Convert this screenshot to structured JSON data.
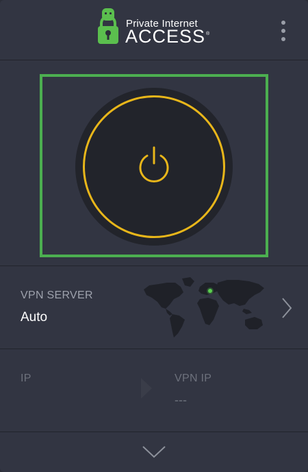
{
  "header": {
    "logo_top": "Private Internet",
    "logo_main": "ACCESS",
    "logo_reg": "®"
  },
  "connect": {
    "state": "disconnected",
    "ring_color": "#e8b61a",
    "focus_color": "#4caf50"
  },
  "server": {
    "label": "VPN SERVER",
    "value": "Auto",
    "location_marker_color": "#4caf50"
  },
  "ip": {
    "label": "IP",
    "value": "",
    "vpn_label": "VPN IP",
    "vpn_value": "---"
  },
  "icons": {
    "menu": "kebab-menu-icon",
    "power": "power-icon",
    "server_chevron": "chevron-right-icon",
    "ip_arrow": "arrow-right-icon",
    "expand": "chevron-down-icon"
  }
}
